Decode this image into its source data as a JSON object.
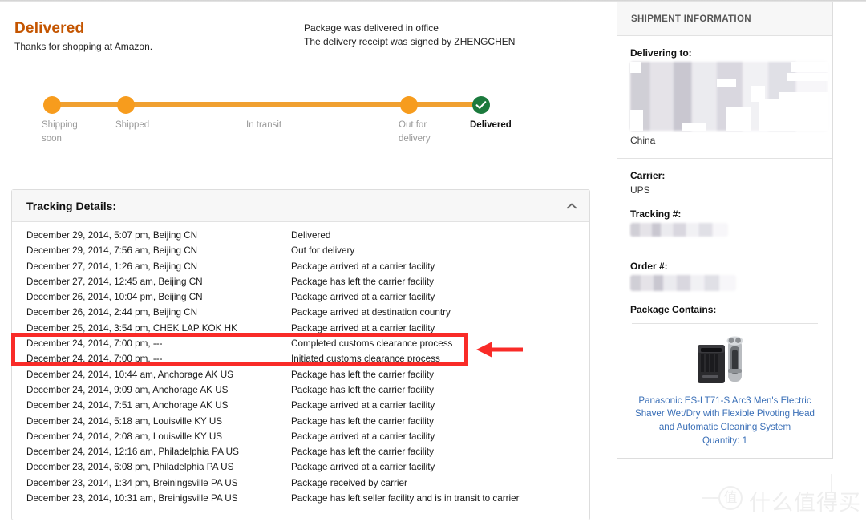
{
  "header": {
    "status_title": "Delivered",
    "status_subtitle": "Thanks for shopping at Amazon.",
    "notes": [
      "Package was delivered in office",
      "The delivery receipt was signed by ZHENGCHEN"
    ]
  },
  "tracker": {
    "steps": [
      {
        "label": "Shipping soon",
        "state": "complete"
      },
      {
        "label": "Shipped",
        "state": "complete"
      },
      {
        "label": "In transit",
        "state": "complete"
      },
      {
        "label": "Out for delivery",
        "state": "complete"
      },
      {
        "label": "Delivered",
        "state": "current"
      }
    ],
    "colors": {
      "bar": "#F0A030",
      "node": "#F79C1D",
      "done": "#1B7A3D"
    }
  },
  "tracking_panel": {
    "title": "Tracking Details:",
    "collapse_icon": "chevron-up-icon",
    "rows": [
      {
        "date": "December 29, 2014, 5:07 pm, Beijing CN",
        "desc": "Delivered"
      },
      {
        "date": "December 29, 2014, 7:56 am, Beijing CN",
        "desc": "Out for delivery"
      },
      {
        "date": "December 27, 2014, 1:26 am, Beijing CN",
        "desc": "Package arrived at a carrier facility"
      },
      {
        "date": "December 27, 2014, 12:45 am, Beijing CN",
        "desc": "Package has left the carrier facility"
      },
      {
        "date": "December 26, 2014, 10:04 pm, Beijing CN",
        "desc": "Package arrived at a carrier facility"
      },
      {
        "date": "December 26, 2014, 2:44 pm, Beijing CN",
        "desc": "Package arrived at destination country"
      },
      {
        "date": "December 25, 2014, 3:54 pm, CHEK LAP KOK HK",
        "desc": "Package arrived at a carrier facility"
      },
      {
        "date": "December 24, 2014, 7:00 pm, ---",
        "desc": "Completed customs clearance process"
      },
      {
        "date": "December 24, 2014, 7:00 pm, ---",
        "desc": "Initiated customs clearance process"
      },
      {
        "date": "December 24, 2014, 10:44 am, Anchorage AK US",
        "desc": "Package has left the carrier facility"
      },
      {
        "date": "December 24, 2014, 9:09 am, Anchorage AK US",
        "desc": "Package has left the carrier facility"
      },
      {
        "date": "December 24, 2014, 7:51 am, Anchorage AK US",
        "desc": "Package arrived at a carrier facility"
      },
      {
        "date": "December 24, 2014, 5:18 am, Louisville KY US",
        "desc": "Package has left the carrier facility"
      },
      {
        "date": "December 24, 2014, 2:08 am, Louisville KY US",
        "desc": "Package arrived at a carrier facility"
      },
      {
        "date": "December 24, 2014, 12:16 am, Philadelphia PA US",
        "desc": "Package has left the carrier facility"
      },
      {
        "date": "December 23, 2014, 6:08 pm, Philadelphia PA US",
        "desc": "Package arrived at a carrier facility"
      },
      {
        "date": "December 23, 2014, 1:34 pm, Breiningsville PA US",
        "desc": "Package received by carrier"
      },
      {
        "date": "December 23, 2014, 10:31 am, Breinigsville PA US",
        "desc": "Package has left seller facility and is in transit to carrier"
      }
    ]
  },
  "annotation": {
    "box_color": "#F92B28",
    "arrow_icon": "left-arrow-icon",
    "highlighted_row_indices": [
      7,
      8
    ]
  },
  "sidebar": {
    "heading": "SHIPMENT INFORMATION",
    "delivering_to": {
      "label": "Delivering to:",
      "address_redacted": true,
      "country": "China"
    },
    "carrier": {
      "label": "Carrier:",
      "value": "UPS"
    },
    "tracking_number": {
      "label": "Tracking #:",
      "value_redacted": true
    },
    "order_number": {
      "label": "Order #:",
      "value_redacted": true
    },
    "package_contains": {
      "label": "Package Contains:",
      "product_name": "Panasonic ES-LT71-S Arc3 Men's Electric Shaver Wet/Dry with Flexible Pivoting Head and Automatic Cleaning System",
      "quantity": "Quantity: 1",
      "thumbnail": "electric-shaver-image"
    }
  },
  "watermark": {
    "logo_char": "值",
    "text": "什么值得买"
  }
}
